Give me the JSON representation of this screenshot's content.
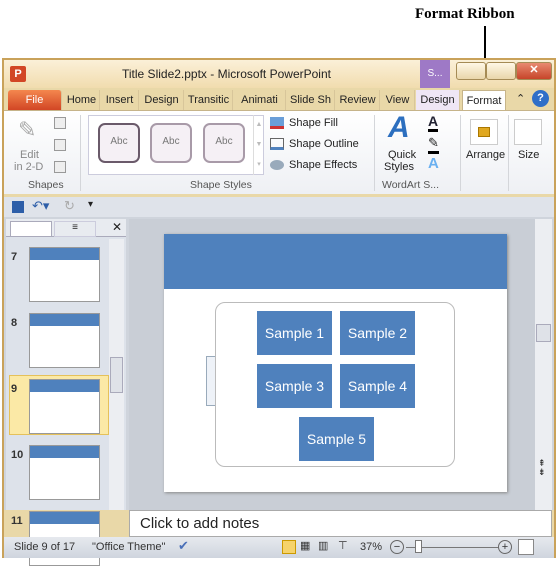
{
  "annotation": {
    "label": "Format Ribbon"
  },
  "window": {
    "title": "Title Slide2.pptx  -  Microsoft PowerPoint",
    "context_tab": "S..."
  },
  "tabs": [
    "File",
    "Home",
    "Insert",
    "Design",
    "Transitic",
    "Animati",
    "Slide Sh",
    "Review",
    "View",
    "Design",
    "Format"
  ],
  "ribbon": {
    "shapes": {
      "edit": "Edit",
      "edit2": "in 2-D",
      "label": "Shapes"
    },
    "styles": {
      "items": [
        "Abc",
        "Abc",
        "Abc"
      ],
      "fill": "Shape Fill",
      "outline": "Shape Outline",
      "effects": "Shape Effects",
      "label": "Shape Styles"
    },
    "wordart": {
      "quick": "Quick",
      "quick2": "Styles",
      "label": "WordArt S..."
    },
    "arrange": "Arrange",
    "size": "Size"
  },
  "thumbnails": [
    "7",
    "8",
    "9",
    "10",
    "11"
  ],
  "selected_slide": "9",
  "slide": {
    "boxes": [
      "Sample 1",
      "Sample 2",
      "Sample 3",
      "Sample 4",
      "Sample 5"
    ],
    "box_color": "#4f81bd"
  },
  "notes": {
    "placeholder": "Click to add notes"
  },
  "status": {
    "slide": "Slide 9 of 17",
    "theme": "\"Office Theme\"",
    "zoom": "37%"
  }
}
